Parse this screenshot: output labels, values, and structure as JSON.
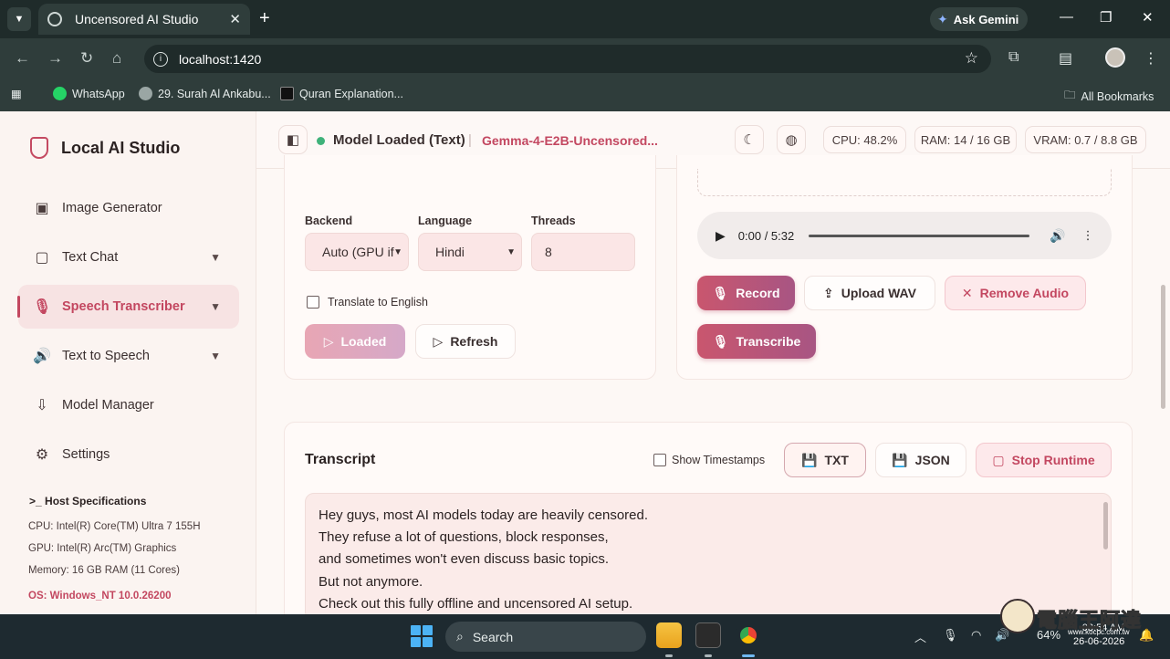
{
  "browser": {
    "tab_title": "Uncensored AI Studio",
    "new_tab": "+",
    "gemini": "Ask Gemini",
    "url": "localhost:1420",
    "bookmarks": [
      {
        "label": "WhatsApp",
        "color": "#25d366"
      },
      {
        "label": "29. Surah Al Ankabu...",
        "color": "#9aa6a4"
      },
      {
        "label": "Quran Explanation...",
        "color": "#111111"
      }
    ],
    "all_bookmarks": "All Bookmarks"
  },
  "sidebar": {
    "brand": "Local AI Studio",
    "items": [
      {
        "label": "Image Generator",
        "icon": "image-icon",
        "glyph": "▣",
        "chevron": false,
        "active": false
      },
      {
        "label": "Text Chat",
        "icon": "chat-icon",
        "glyph": "▢",
        "chevron": true,
        "active": false
      },
      {
        "label": "Speech Transcriber",
        "icon": "microphone-icon",
        "glyph": "🎙",
        "chevron": true,
        "active": true
      },
      {
        "label": "Text to Speech",
        "icon": "speaker-icon",
        "glyph": "🔊",
        "chevron": true,
        "active": false
      },
      {
        "label": "Model Manager",
        "icon": "download-box-icon",
        "glyph": "⇩",
        "chevron": false,
        "active": false
      },
      {
        "label": "Settings",
        "icon": "gear-icon",
        "glyph": "⚙",
        "chevron": false,
        "active": false
      }
    ],
    "host_title": "Host Specifications",
    "host_prompt": ">_",
    "host_specs": [
      "CPU: Intel(R) Core(TM) Ultra 7 155H",
      "GPU: Intel(R) Arc(TM) Graphics",
      "Memory: 16 GB RAM (11 Cores)"
    ],
    "os": "OS: Windows_NT 10.0.26200"
  },
  "header": {
    "status": "Model Loaded (Text)",
    "separator": "|",
    "model": "Gemma-4-E2B-Uncensored...",
    "cpu": "CPU: 48.2%",
    "ram": "RAM: 14 / 16 GB",
    "vram": "VRAM: 0.7 / 8.8 GB"
  },
  "settings_panel": {
    "backend_label": "Backend",
    "backend_value": "Auto (GPU if",
    "language_label": "Language",
    "language_value": "Hindi",
    "threads_label": "Threads",
    "threads_value": "8",
    "translate_label": "Translate to English",
    "loaded_btn": "Loaded",
    "refresh_btn": "Refresh"
  },
  "audio_panel": {
    "time": "0:00 / 5:32",
    "record_btn": "Record",
    "upload_btn": "Upload WAV",
    "remove_btn": "Remove Audio",
    "transcribe_btn": "Transcribe"
  },
  "transcript": {
    "title": "Transcript",
    "show_timestamps": "Show Timestamps",
    "txt_btn": "TXT",
    "json_btn": "JSON",
    "stop_btn": "Stop Runtime",
    "lines": [
      "Hey guys, most AI models today are heavily censored.",
      "They refuse a lot of questions, block responses,",
      "and sometimes won't even discuss basic topics.",
      "But not anymore.",
      "Check out this fully offline and uncensored AI setup."
    ]
  },
  "taskbar": {
    "search": "Search",
    "battery": "64%",
    "time": "08:54 AM",
    "date": "26-06-2026",
    "watermark": "電腦王阿達",
    "watermark_url": "www.kocpc.com.tw"
  }
}
